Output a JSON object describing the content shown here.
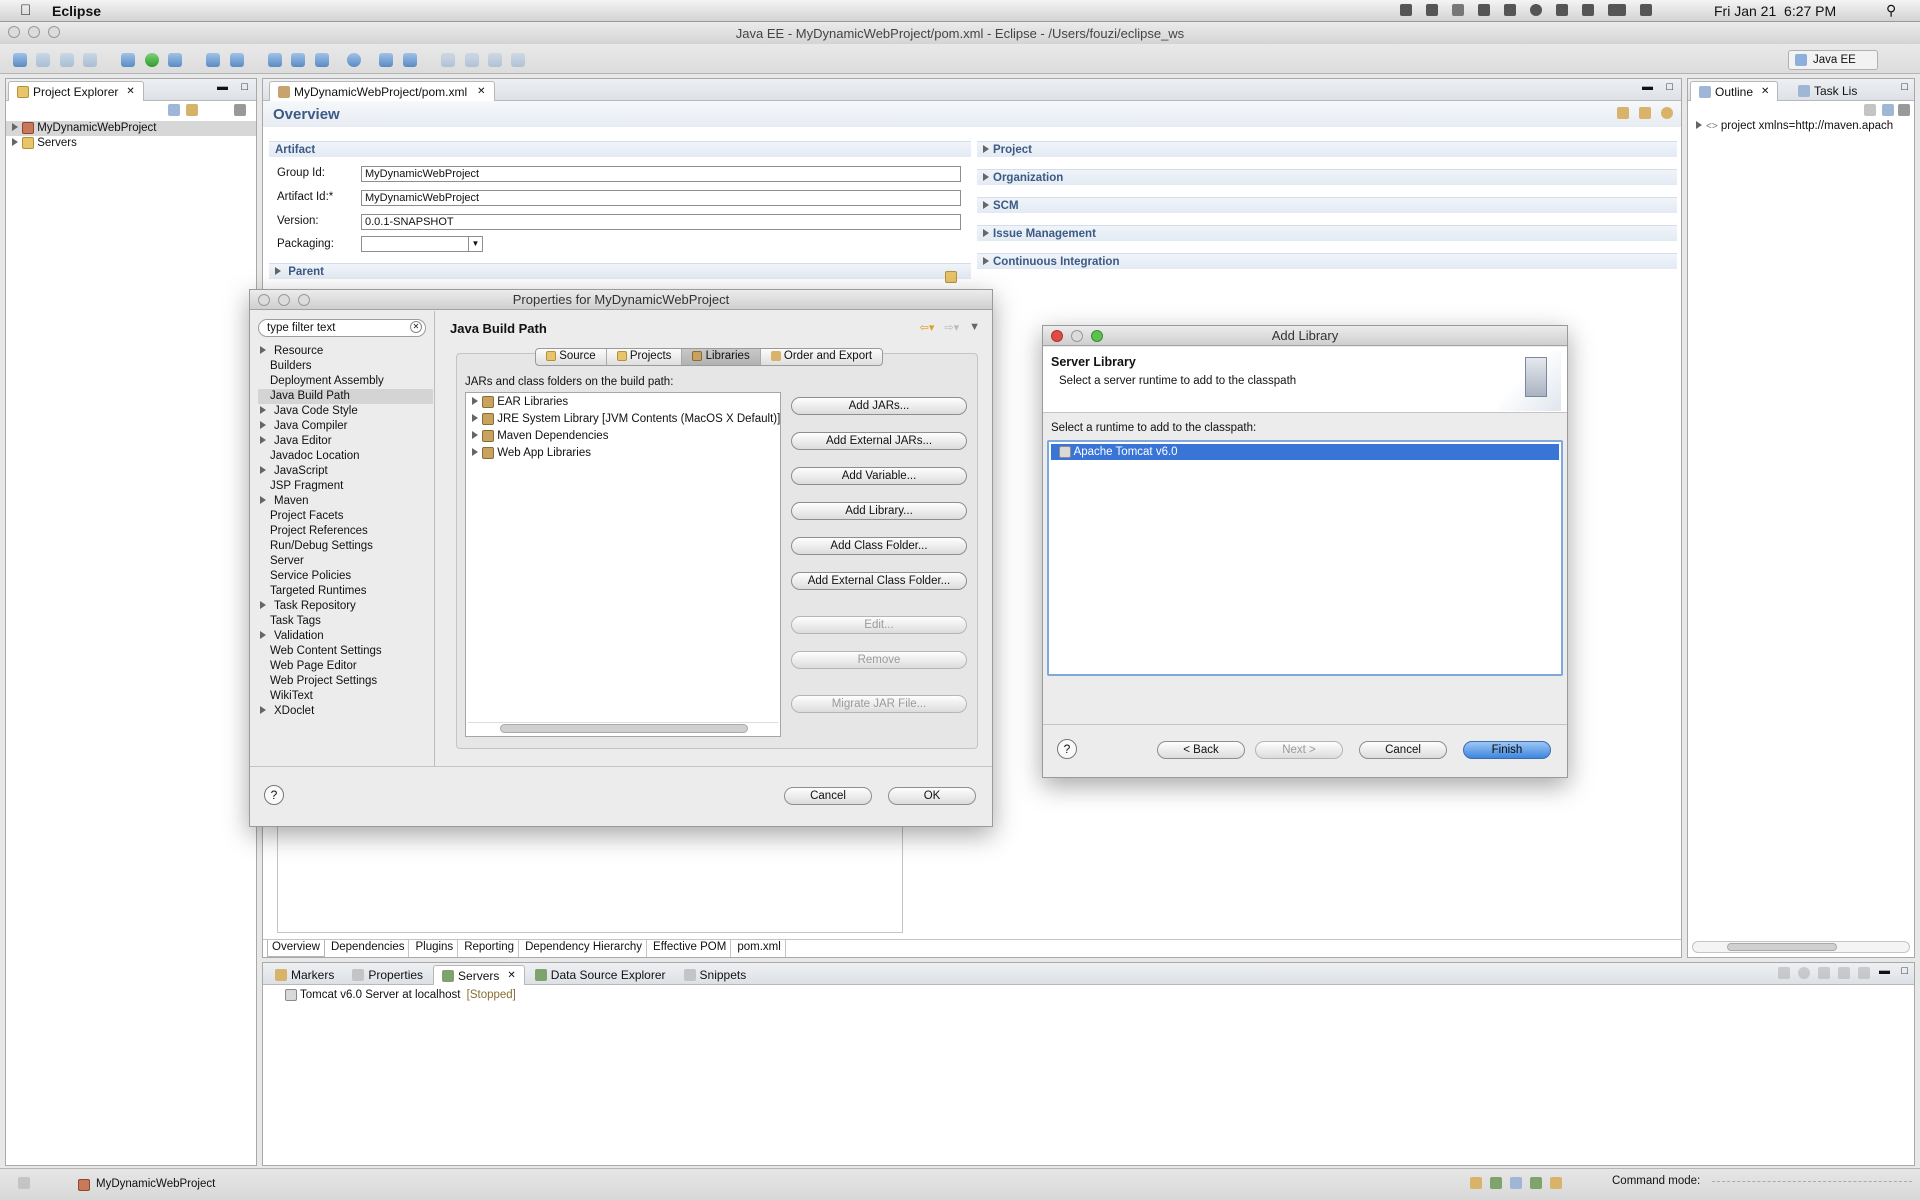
{
  "menubar": {
    "app_name": "Eclipse",
    "datetime": "Fri Jan 21  6:27 PM"
  },
  "window": {
    "title": "Java EE - MyDynamicWebProject/pom.xml - Eclipse - /Users/fouzi/eclipse_ws",
    "perspective": "Java EE"
  },
  "project_explorer": {
    "tab_label": "Project Explorer",
    "items": [
      {
        "label": "MyDynamicWebProject"
      },
      {
        "label": "Servers"
      }
    ]
  },
  "editor": {
    "tab_label": "MyDynamicWebProject/pom.xml",
    "overview_title": "Overview",
    "artifact": {
      "section_label": "Artifact",
      "group_id_label": "Group Id:",
      "group_id_value": "MyDynamicWebProject",
      "artifact_id_label": "Artifact Id:*",
      "artifact_id_value": "MyDynamicWebProject",
      "version_label": "Version:",
      "version_value": "0.0.1-SNAPSHOT",
      "packaging_label": "Packaging:",
      "parent_label": "Parent"
    },
    "right_sections": [
      "Project",
      "Organization",
      "SCM",
      "Issue Management",
      "Continuous Integration"
    ],
    "bottom_tabs": [
      "Overview",
      "Dependencies",
      "Plugins",
      "Reporting",
      "Dependency Hierarchy",
      "Effective POM",
      "pom.xml"
    ]
  },
  "outline": {
    "tab_label": "Outline",
    "tab2_label": "Task Lis",
    "item": "project xmlns=http://maven.apach"
  },
  "servers_view": {
    "tabs": [
      "Markers",
      "Properties",
      "Servers",
      "Data Source Explorer",
      "Snippets"
    ],
    "server_name": "Tomcat v6.0 Server at localhost",
    "server_status": "[Stopped]"
  },
  "status_bar": {
    "project": "MyDynamicWebProject",
    "command_mode": "Command mode:"
  },
  "properties_dialog": {
    "title": "Properties for MyDynamicWebProject",
    "filter_placeholder": "type filter text",
    "nav_items": [
      {
        "label": "Resource",
        "expand": true
      },
      {
        "label": "Builders",
        "expand": false
      },
      {
        "label": "Deployment Assembly",
        "expand": false
      },
      {
        "label": "Java Build Path",
        "expand": false,
        "selected": true
      },
      {
        "label": "Java Code Style",
        "expand": true
      },
      {
        "label": "Java Compiler",
        "expand": true
      },
      {
        "label": "Java Editor",
        "expand": true
      },
      {
        "label": "Javadoc Location",
        "expand": false
      },
      {
        "label": "JavaScript",
        "expand": true
      },
      {
        "label": "JSP Fragment",
        "expand": false
      },
      {
        "label": "Maven",
        "expand": true
      },
      {
        "label": "Project Facets",
        "expand": false
      },
      {
        "label": "Project References",
        "expand": false
      },
      {
        "label": "Run/Debug Settings",
        "expand": false
      },
      {
        "label": "Server",
        "expand": false
      },
      {
        "label": "Service Policies",
        "expand": false
      },
      {
        "label": "Targeted Runtimes",
        "expand": false
      },
      {
        "label": "Task Repository",
        "expand": true
      },
      {
        "label": "Task Tags",
        "expand": false
      },
      {
        "label": "Validation",
        "expand": true
      },
      {
        "label": "Web Content Settings",
        "expand": false
      },
      {
        "label": "Web Page Editor",
        "expand": false
      },
      {
        "label": "Web Project Settings",
        "expand": false
      },
      {
        "label": "WikiText",
        "expand": false
      },
      {
        "label": "XDoclet",
        "expand": true
      }
    ],
    "page_title": "Java Build Path",
    "tabs": [
      "Source",
      "Projects",
      "Libraries",
      "Order and Export"
    ],
    "jars_label": "JARs and class folders on the build path:",
    "libraries": [
      "EAR Libraries",
      "JRE System Library [JVM Contents (MacOS X Default)]",
      "Maven Dependencies",
      "Web App Libraries"
    ],
    "buttons": {
      "add_jars": "Add JARs...",
      "add_external_jars": "Add External JARs...",
      "add_variable": "Add Variable...",
      "add_library": "Add Library...",
      "add_class_folder": "Add Class Folder...",
      "add_external_class_folder": "Add External Class Folder...",
      "edit": "Edit...",
      "remove": "Remove",
      "migrate": "Migrate JAR File..."
    },
    "cancel": "Cancel",
    "ok": "OK"
  },
  "add_library_dialog": {
    "title": "Add Library",
    "header_title": "Server Library",
    "header_desc": "Select a server runtime to add to the classpath",
    "list_label": "Select a runtime to add to the classpath:",
    "runtimes": [
      "Apache Tomcat v6.0"
    ],
    "back": "< Back",
    "next": "Next >",
    "cancel": "Cancel",
    "finish": "Finish"
  }
}
